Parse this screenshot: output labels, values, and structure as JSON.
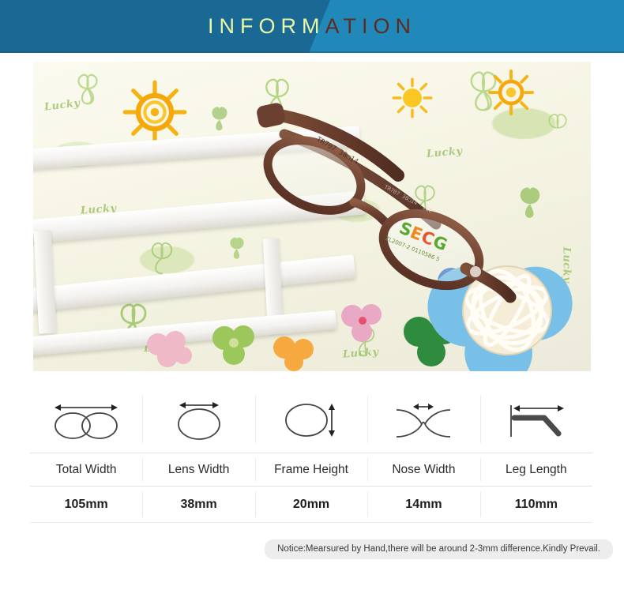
{
  "header": {
    "title_part_a": "INFORM",
    "title_part_b": "ATION",
    "full_title": "INFORMATION",
    "bg_left_color": "#1a6894",
    "bg_right_color": "#2189b9",
    "text_left_color": "#e9f7a8",
    "text_right_color": "#5f2a22"
  },
  "photo": {
    "alt": "Brown kids eyeglasses resting on a white wooden bench over clover patterned paper",
    "frame_marking": "TR707 38□14",
    "lens_brand": "SECG",
    "lens_code": "ZL2007-2  0110586 5",
    "temple_marking": "TR707  38□14  · 110",
    "background_words": [
      "Lucky",
      "Lucky",
      "Lucky",
      "Lucky",
      "Lucky",
      "Lucky"
    ]
  },
  "spec_table": {
    "columns": [
      {
        "icon": "total-width-icon",
        "label": "Total Width",
        "value": "105mm"
      },
      {
        "icon": "lens-width-icon",
        "label": "Lens Width",
        "value": "38mm"
      },
      {
        "icon": "frame-height-icon",
        "label": "Frame Height",
        "value": "20mm"
      },
      {
        "icon": "nose-width-icon",
        "label": "Nose Width",
        "value": "14mm"
      },
      {
        "icon": "leg-length-icon",
        "label": "Leg Length",
        "value": "110mm"
      }
    ]
  },
  "notice": {
    "text": "Notice:Mearsured by Hand,there will be around 2-3mm difference.Kindly Prevail.",
    "bg_color": "#ededed"
  }
}
